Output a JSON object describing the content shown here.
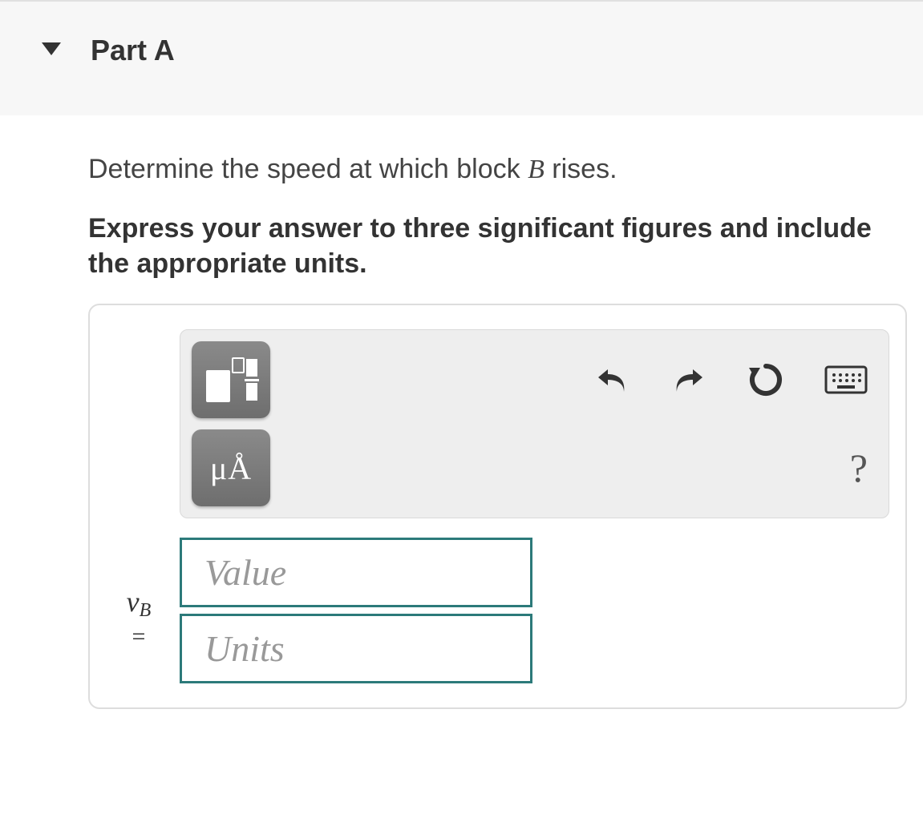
{
  "part": {
    "title": "Part A"
  },
  "prompt": {
    "prefix": "Determine the speed at which block ",
    "variable": "B",
    "suffix": " rises."
  },
  "instructions": "Express your answer to three significant figures and include the appropriate units.",
  "answer": {
    "variable_html": "v",
    "variable_sub": "B",
    "equals": "=",
    "value_placeholder": "Value",
    "units_placeholder": "Units"
  },
  "toolbar": {
    "special_chars": "μÅ",
    "help": "?"
  }
}
